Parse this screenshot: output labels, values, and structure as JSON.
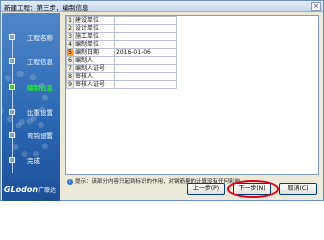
{
  "window": {
    "title": "新建工程：第三步，编制信息",
    "close_label": "×"
  },
  "sidebar": {
    "steps": [
      {
        "label": "工程名称",
        "active": false
      },
      {
        "label": "工程信息",
        "active": false
      },
      {
        "label": "编制信息",
        "active": true
      },
      {
        "label": "比重设置",
        "active": false
      },
      {
        "label": "弯钩设置",
        "active": false
      },
      {
        "label": "完成",
        "active": false
      }
    ],
    "logo_main": "GLodon",
    "logo_sub": "广联达"
  },
  "grid": {
    "rows": [
      {
        "num": "1",
        "name": "建设单位",
        "value": ""
      },
      {
        "num": "2",
        "name": "设计单位",
        "value": ""
      },
      {
        "num": "3",
        "name": "施工单位",
        "value": ""
      },
      {
        "num": "4",
        "name": "编制单位",
        "value": ""
      },
      {
        "num": "5",
        "name": "编制日期",
        "value": "2016-01-06"
      },
      {
        "num": "6",
        "name": "编制人",
        "value": ""
      },
      {
        "num": "7",
        "name": "编制人证号",
        "value": ""
      },
      {
        "num": "8",
        "name": "审核人",
        "value": ""
      },
      {
        "num": "9",
        "name": "审核人证号",
        "value": ""
      }
    ],
    "selected_row": 5
  },
  "note": {
    "icon": "info-icon",
    "text": "提示：该部分内容只起到标识的作用，对钢筋量的计算没有任何影响。"
  },
  "buttons": {
    "prev": "上一步(P)",
    "next": "下一步(N)",
    "cancel": "取消(C)"
  },
  "colors": {
    "sidebar": "#2c68b4",
    "active_step": "#2ae43a",
    "selected_row": "#f7a12a",
    "highlight_ring": "#e1001c"
  }
}
